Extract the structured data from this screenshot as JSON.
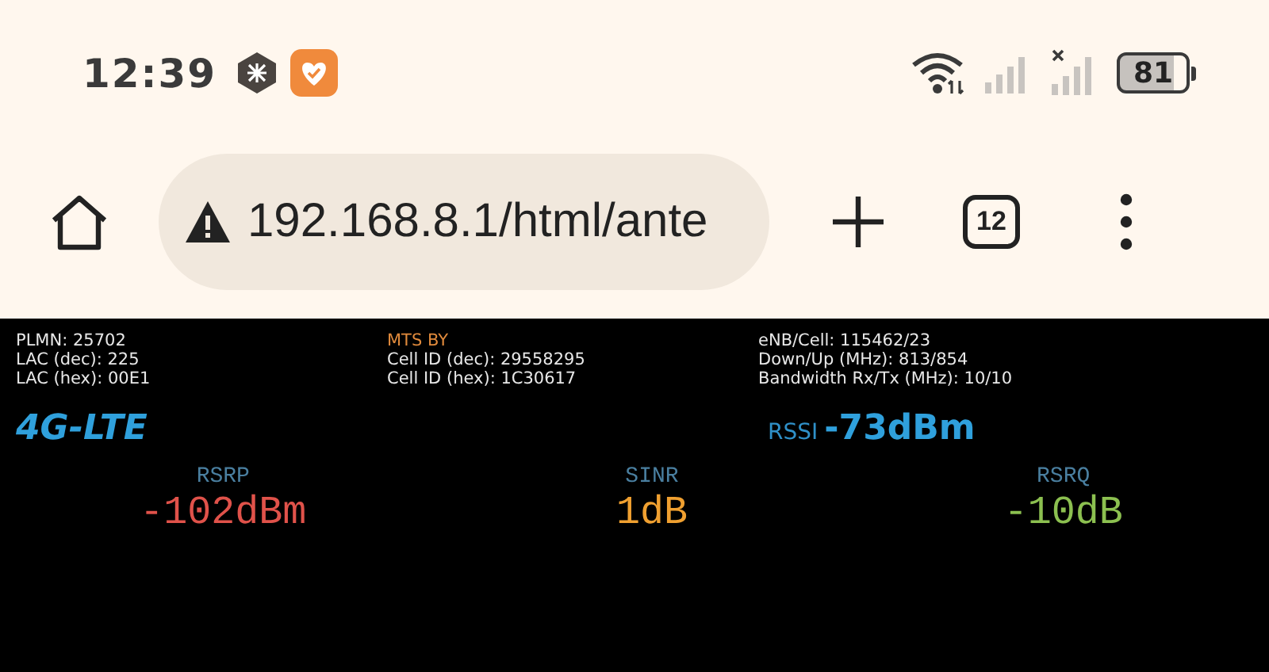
{
  "status_bar": {
    "time": "12:39",
    "battery": "81"
  },
  "browser": {
    "url": "192.168.8.1/html/ante",
    "tab_count": "12"
  },
  "info_columns": [
    {
      "lines": [
        {
          "text": "PLMN: 25702",
          "kind": "plain"
        },
        {
          "text": "LAC (dec): 225",
          "kind": "plain"
        },
        {
          "text": "LAC (hex): 00E1",
          "kind": "plain"
        }
      ]
    },
    {
      "lines": [
        {
          "text": "MTS BY",
          "kind": "operator"
        },
        {
          "text": "Cell ID (dec): 29558295",
          "kind": "plain"
        },
        {
          "text": "Cell ID (hex): 1C30617",
          "kind": "plain"
        }
      ]
    },
    {
      "lines": [
        {
          "text": "eNB/Cell: 115462/23",
          "kind": "plain"
        },
        {
          "text": "Down/Up (MHz): 813/854",
          "kind": "plain"
        },
        {
          "text": "Bandwidth Rx/Tx (MHz): 10/10",
          "kind": "plain"
        }
      ]
    }
  ],
  "network_mode": "4G-LTE",
  "rssi": {
    "label": "RSSI",
    "value": "-73dBm"
  },
  "metrics": [
    {
      "label": "RSRP",
      "value": "-102dBm",
      "color": "#e0524a"
    },
    {
      "label": "SINR",
      "value": "1dB",
      "color": "#f0a030"
    },
    {
      "label": "RSRQ",
      "value": "-10dB",
      "color": "#8cc050"
    }
  ]
}
